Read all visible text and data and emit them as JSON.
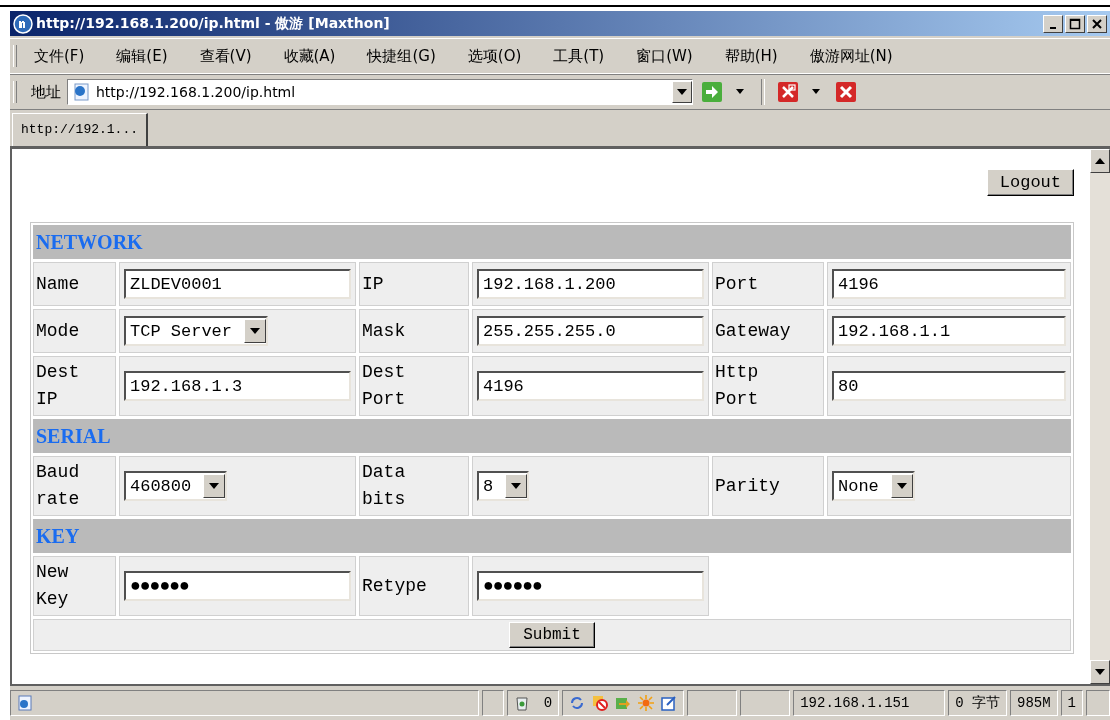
{
  "window": {
    "title": "http://192.168.1.200/ip.html - 傲游 [Maxthon]"
  },
  "menu": [
    "文件(F)",
    "编辑(E)",
    "查看(V)",
    "收藏(A)",
    "快捷组(G)",
    "选项(O)",
    "工具(T)",
    "窗口(W)",
    "帮助(H)",
    "傲游网址(N)"
  ],
  "address_bar": {
    "label": "地址",
    "url": "http://192.168.1.200/ip.html"
  },
  "tabs": [
    {
      "label": "http://192.1...",
      "selected": true
    }
  ],
  "logout_button": "Logout",
  "sections": [
    {
      "title": "NETWORK",
      "rows": [
        [
          {
            "label": "Name",
            "kind": "text",
            "value": "ZLDEV0001"
          },
          {
            "label": "IP",
            "kind": "text",
            "value": "192.168.1.200"
          },
          {
            "label": "Port",
            "kind": "text",
            "value": "4196"
          }
        ],
        [
          {
            "label": "Mode",
            "kind": "select",
            "value": "TCP Server"
          },
          {
            "label": "Mask",
            "kind": "text",
            "value": "255.255.255.0"
          },
          {
            "label": "Gateway",
            "kind": "text",
            "value": "192.168.1.1"
          }
        ],
        [
          {
            "label": "Dest IP",
            "kind": "text",
            "value": "192.168.1.3"
          },
          {
            "label": "Dest Port",
            "kind": "text",
            "value": "4196"
          },
          {
            "label": "Http Port",
            "kind": "text",
            "value": "80"
          }
        ]
      ]
    },
    {
      "title": "SERIAL",
      "rows": [
        [
          {
            "label": "Baud rate",
            "kind": "select",
            "value": "460800"
          },
          {
            "label": "Data bits",
            "kind": "select",
            "value": "8"
          },
          {
            "label": "Parity",
            "kind": "select",
            "value": "None"
          }
        ]
      ]
    },
    {
      "title": "KEY",
      "rows": [
        [
          {
            "label": "New Key",
            "kind": "password",
            "value": "●●●●●●"
          },
          {
            "label": "Retype",
            "kind": "password",
            "value": "●●●●●●"
          }
        ]
      ]
    }
  ],
  "submit_button": "Submit",
  "status_bar": {
    "counter": "0",
    "ip": "192.168.1.151",
    "bytes": "0 字节",
    "memory": "985M",
    "count": "1"
  }
}
